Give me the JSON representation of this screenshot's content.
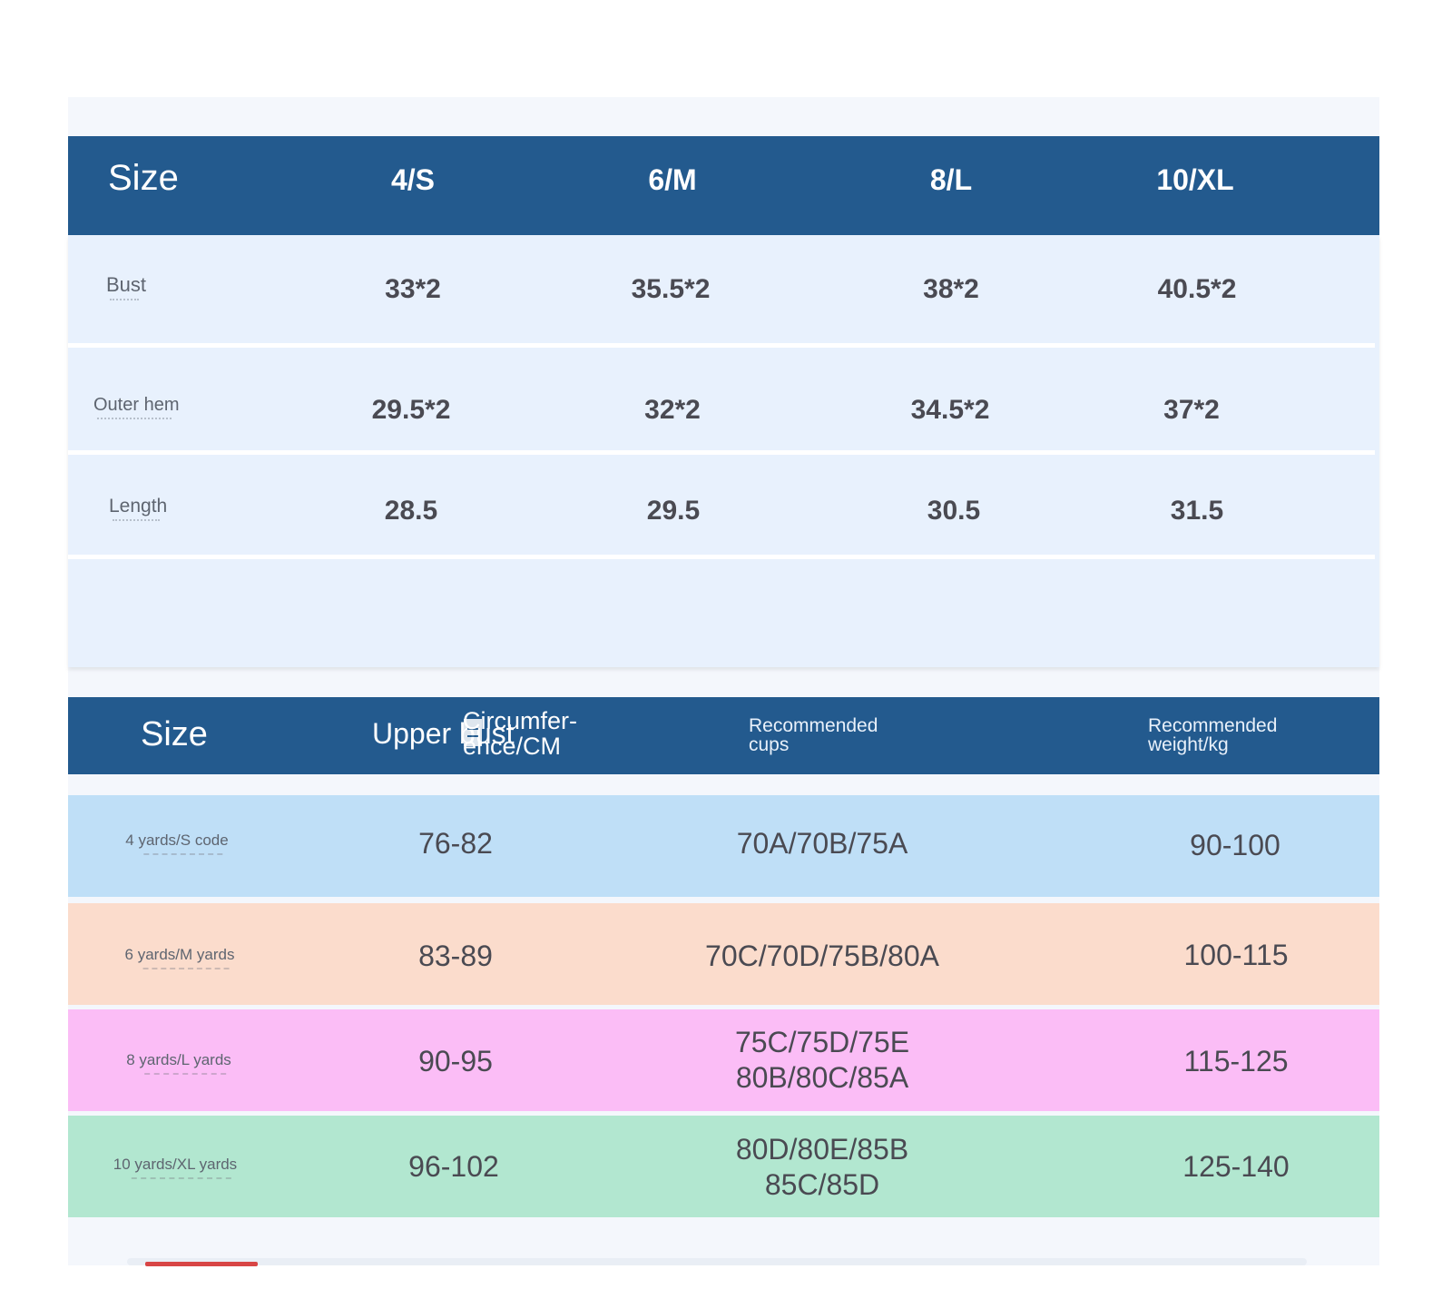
{
  "table1": {
    "title": "Size",
    "columns": [
      "4/S",
      "6/M",
      "8/L",
      "10/XL"
    ],
    "rows": [
      {
        "label": "Bust",
        "values": [
          "33*2",
          "35.5*2",
          "38*2",
          "40.5*2"
        ]
      },
      {
        "label": "Outer hem",
        "values": [
          "29.5*2",
          "32*2",
          "34.5*2",
          "37*2"
        ]
      },
      {
        "label": "Length",
        "values": [
          "28.5",
          "29.5",
          "30.5",
          "31.5"
        ]
      }
    ]
  },
  "table2": {
    "title": "Size",
    "header_upper": "Upper bust",
    "header_circumference": "Circumfer-ence/CM",
    "header_cups": "Recommended cups",
    "header_weight": "Recommended weight/kg",
    "rows": [
      {
        "label": "4 yards/S code",
        "bust": "76-82",
        "cups": [
          "70A/70B/75A"
        ],
        "weight": "90-100",
        "color": "#bfdff7"
      },
      {
        "label": "6 yards/M yards",
        "bust": "83-89",
        "cups": [
          "70C/70D/75B/80A"
        ],
        "weight": "100-115",
        "color": "#fbdccc"
      },
      {
        "label": "8 yards/L yards",
        "bust": "90-95",
        "cups": [
          "75C/75D/75E",
          "80B/80C/85A"
        ],
        "weight": "115-125",
        "color": "#fbbdf6"
      },
      {
        "label": "10 yards/XL yards",
        "bust": "96-102",
        "cups": [
          "80D/80E/85B",
          "85C/85D"
        ],
        "weight": "125-140",
        "color": "#b2e7d0"
      }
    ]
  },
  "colors": {
    "header_blue": "#235a8e",
    "panel_light_blue": "#e8f1fd",
    "accent_red": "#d84545"
  }
}
